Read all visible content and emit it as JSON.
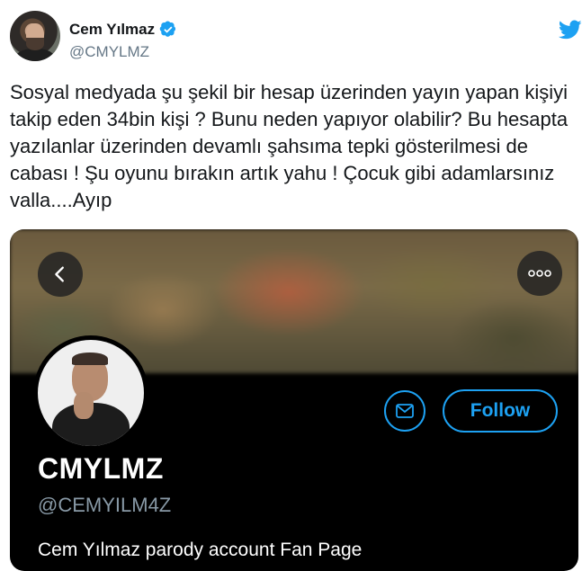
{
  "tweet": {
    "author": {
      "name": "Cem Yılmaz",
      "handle": "@CMYLMZ",
      "verified": true
    },
    "text": "Sosyal medyada şu şekil bir hesap üzerinden yayın yapan kişiyi takip eden 34bin kişi ? Bunu neden yapıyor olabilir? Bu hesapta yazılanlar üzerinden devamlı şahsıma tepki gösterilmesi de cabası ! Şu oyunu bırakın artık yahu ! Çocuk gibi adamlarsınız valla....Ayıp",
    "icons": {
      "brand": "twitter-bird-icon",
      "verified": "verified-badge-icon"
    }
  },
  "embedded_profile": {
    "display_name": "CMYLMZ",
    "handle": "@CEMYILM4Z",
    "bio": "Cem Yılmaz parody account Fan Page",
    "follow_label": "Follow",
    "icons": {
      "back": "back-arrow-icon",
      "more": "more-options-icon",
      "message": "message-envelope-icon"
    }
  },
  "colors": {
    "accent": "#1da1f2",
    "text_primary": "#14171a",
    "text_secondary": "#657786",
    "card_bg": "#000000",
    "handle_gray": "#8899a6"
  }
}
